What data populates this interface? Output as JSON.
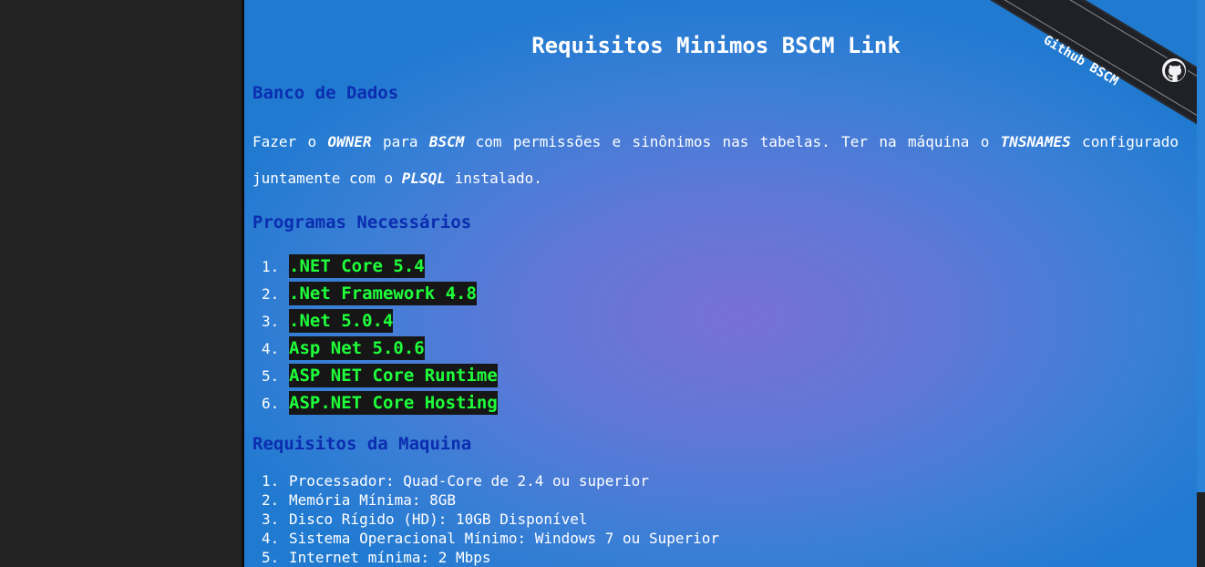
{
  "ribbon": {
    "label": "Github BSCM",
    "icon": "github-icon"
  },
  "title": "Requisitos Minimos BSCM Link",
  "sections": {
    "database": {
      "title": "Banco de Dados",
      "text_1": "Fazer o ",
      "owner": "OWNER",
      "text_2": " para ",
      "bscm": "BSCM",
      "text_3": " com permissões e sinônimos nas tabelas. Ter na máquina o ",
      "tnsnames": "TNSNAMES",
      "text_4": " configurado juntamente com o ",
      "plsql": "PLSQL",
      "text_5": " instalado."
    },
    "programs": {
      "title": "Programas Necessários",
      "items": [
        {
          "num": "1.",
          "label": ".NET Core 5.4"
        },
        {
          "num": "2.",
          "label": ".Net Framework 4.8"
        },
        {
          "num": "3.",
          "label": ".Net 5.0.4"
        },
        {
          "num": "4.",
          "label": "Asp Net 5.0.6"
        },
        {
          "num": "5.",
          "label": "ASP NET Core Runtime"
        },
        {
          "num": "6.",
          "label": "ASP.NET Core Hosting"
        }
      ]
    },
    "machine": {
      "title": "Requisitos da Maquina",
      "items": [
        {
          "num": "1.",
          "label": "Processador: Quad-Core de 2.4 ou superior"
        },
        {
          "num": "2.",
          "label": "Memória Mínima: 8GB"
        },
        {
          "num": "3.",
          "label": "Disco Rígido (HD): 10GB Disponível"
        },
        {
          "num": "4.",
          "label": "Sistema Operacional Mínimo: Windows 7 ou Superior"
        },
        {
          "num": "5.",
          "label": "Internet mínima: 2 Mbps"
        }
      ]
    }
  },
  "colors": {
    "heading": "#0b2db0",
    "program_text": "#1eff3a",
    "program_bg": "#161616"
  }
}
